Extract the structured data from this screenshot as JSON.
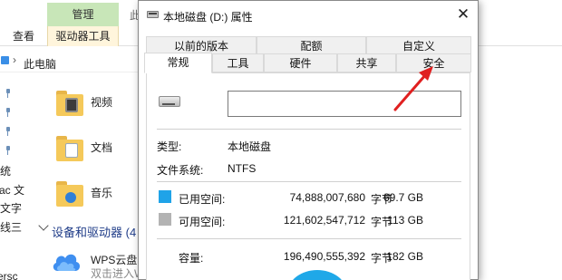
{
  "explorer": {
    "ribbon": {
      "manage_tab": "管理",
      "top_fragment": "此",
      "view_tab": "查看",
      "drive_tools_tab": "驱动器工具"
    },
    "address": {
      "separator": "›",
      "path": "此电脑"
    },
    "left_fragments": [
      "统",
      "ac 文",
      "文字",
      "线三",
      "ersc"
    ],
    "libraries": [
      {
        "label": "视频",
        "icon": "video-folder-icon"
      },
      {
        "label": "文档",
        "icon": "document-folder-icon"
      },
      {
        "label": "音乐",
        "icon": "music-folder-icon"
      }
    ],
    "section": {
      "title": "设备和驱动器 (4"
    },
    "cloud": {
      "title": "WPS云盘",
      "subtitle": "双击进入W",
      "icon": "wps-cloud-icon"
    }
  },
  "dialog": {
    "title": "本地磁盘 (D:) 属性",
    "close": "✕",
    "tabs_row1": [
      "以前的版本",
      "配额",
      "自定义"
    ],
    "tabs_row2": [
      "常规",
      "工具",
      "硬件",
      "共享",
      "安全"
    ],
    "active_tab": "常规",
    "volume_name_value": "",
    "type_label": "类型:",
    "type_value": "本地磁盘",
    "fs_label": "文件系统:",
    "fs_value": "NTFS",
    "used": {
      "label": "已用空间:",
      "bytes": "74,888,007,680",
      "unit": "字节",
      "gb": "69.7 GB",
      "color": "#1fa3e8"
    },
    "free": {
      "label": "可用空间:",
      "bytes": "121,602,547,712",
      "unit": "字节",
      "gb": "113 GB",
      "color": "#b3b3b3"
    },
    "capacity": {
      "label": "容量:",
      "bytes": "196,490,555,392",
      "unit": "字节",
      "gb": "182 GB"
    }
  },
  "annotation": {
    "arrow_color": "#e02020"
  }
}
